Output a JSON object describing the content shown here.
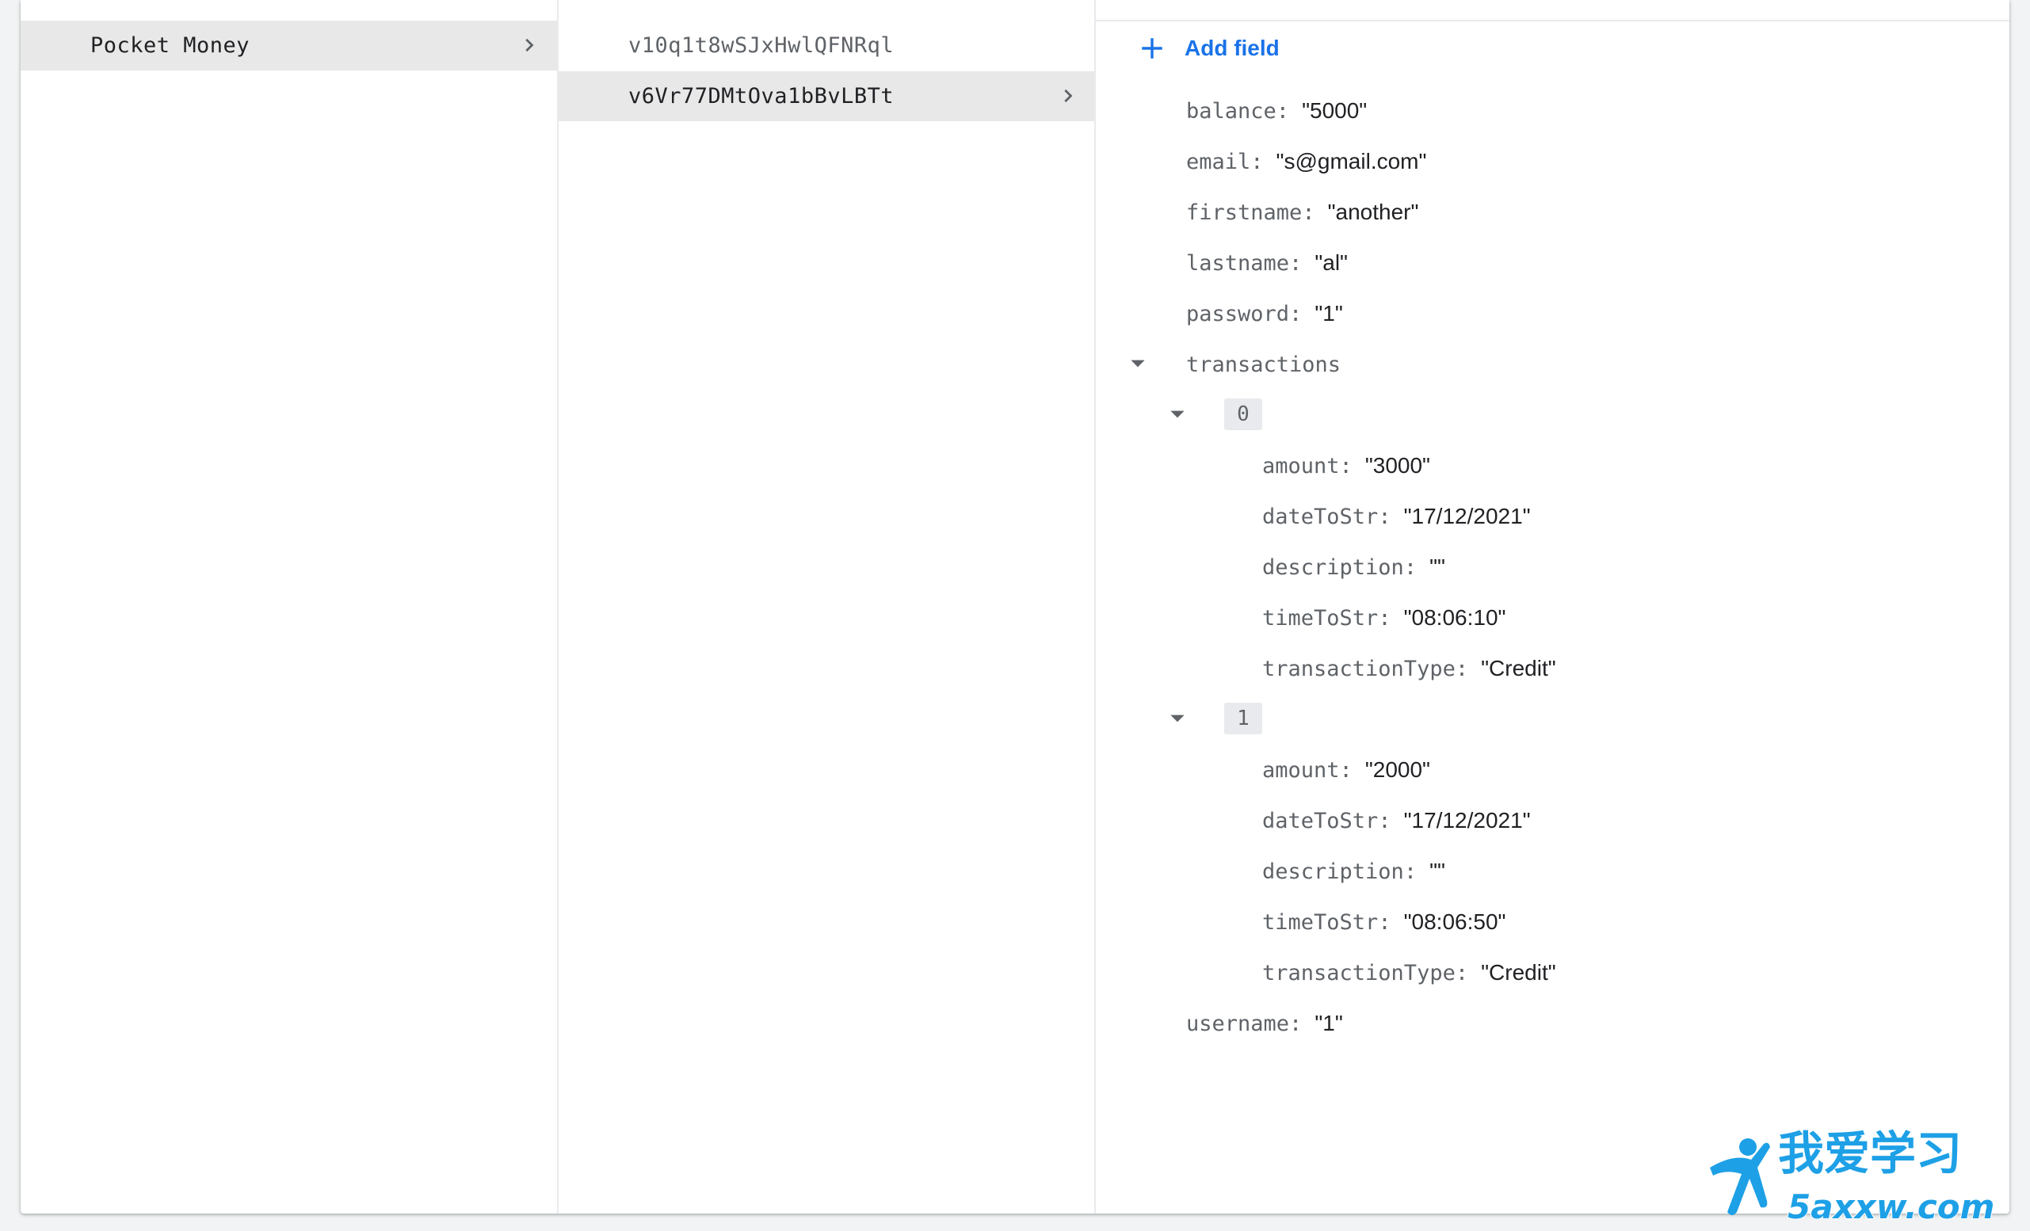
{
  "collections": {
    "items": [
      {
        "label": "Pocket Money",
        "selected": true
      }
    ]
  },
  "documents": {
    "items": [
      {
        "label": "v10q1t8wSJxHwlQFNRql"
      },
      {
        "label": "v6Vr77DMtOva1bBvLBTt"
      }
    ]
  },
  "detail": {
    "add_field_label": "Add field",
    "fields": {
      "balance": {
        "key": "balance",
        "value": "\"5000\""
      },
      "email": {
        "key": "email",
        "value": "\"s@gmail.com\""
      },
      "firstname": {
        "key": "firstname",
        "value": "\"another\""
      },
      "lastname": {
        "key": "lastname",
        "value": "\"al\""
      },
      "password": {
        "key": "password",
        "value": "\"1\""
      },
      "transactions": {
        "key": "transactions"
      },
      "username": {
        "key": "username",
        "value": "\"1\""
      }
    },
    "transactions": [
      {
        "index": "0",
        "amount": {
          "key": "amount",
          "value": "\"3000\""
        },
        "dateToStr": {
          "key": "dateToStr",
          "value": "\"17/12/2021\""
        },
        "description": {
          "key": "description",
          "value": "\"\""
        },
        "timeToStr": {
          "key": "timeToStr",
          "value": "\"08:06:10\""
        },
        "transactionType": {
          "key": "transactionType",
          "value": "\"Credit\""
        }
      },
      {
        "index": "1",
        "amount": {
          "key": "amount",
          "value": "\"2000\""
        },
        "dateToStr": {
          "key": "dateToStr",
          "value": "\"17/12/2021\""
        },
        "description": {
          "key": "description",
          "value": "\"\""
        },
        "timeToStr": {
          "key": "timeToStr",
          "value": "\"08:06:50\""
        },
        "transactionType": {
          "key": "transactionType",
          "value": "\"Credit\""
        }
      }
    ]
  },
  "watermark": {
    "chinese": "我爱学习",
    "site": "5axxw.com"
  },
  "colors": {
    "accent": "#1a73e8",
    "selected_row": "#e8e8e8",
    "key_text": "#5f6368",
    "value_text": "#202124",
    "watermark_blue": "#1ea0e6"
  },
  "icons": {
    "chevron": "chevron-right-icon",
    "add": "plus-icon",
    "expand": "arrow-drop-down-icon"
  }
}
